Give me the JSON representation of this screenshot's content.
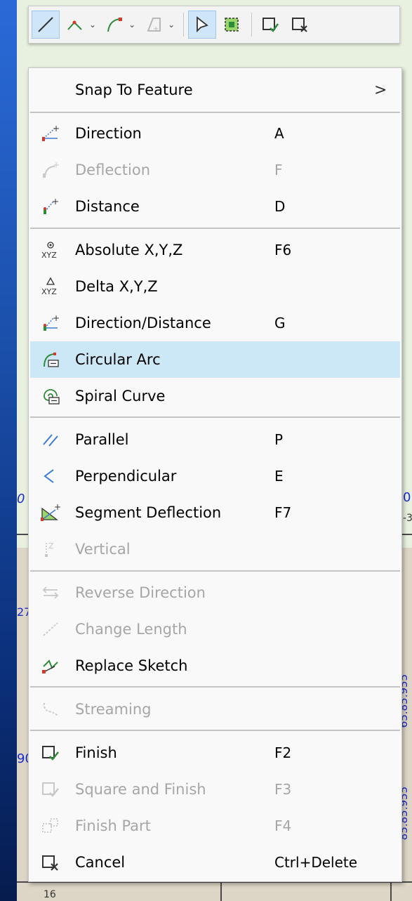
{
  "toolbar": {
    "buttons": [
      {
        "name": "line-segment-icon",
        "active": true
      },
      {
        "name": "polyline-icon",
        "dropdown": true
      },
      {
        "name": "arc-segment-icon",
        "dropdown": true
      },
      {
        "name": "construction-icon",
        "dropdown": true
      },
      {
        "name": "select-arrow-icon",
        "active": true
      },
      {
        "name": "vertex-select-icon"
      },
      {
        "name": "finish-sketch-icon"
      },
      {
        "name": "cancel-sketch-icon"
      }
    ]
  },
  "map": {
    "labels": [
      "0",
      "0",
      "27",
      "90",
      "16",
      "65.85.955",
      "85.85.955",
      "-3"
    ]
  },
  "menu": {
    "items": [
      {
        "id": "snap",
        "label": "Snap To Feature",
        "key": "",
        "submenu": true,
        "enabled": true
      },
      {
        "id": "direction",
        "label": "Direction",
        "key": "A",
        "enabled": true
      },
      {
        "id": "deflection",
        "label": "Deflection",
        "key": "F",
        "enabled": false
      },
      {
        "id": "distance",
        "label": "Distance",
        "key": "D",
        "enabled": true
      },
      {
        "id": "absolute",
        "label": "Absolute X,Y,Z",
        "key": "F6",
        "enabled": true
      },
      {
        "id": "delta",
        "label": "Delta X,Y,Z",
        "key": "",
        "enabled": true
      },
      {
        "id": "dirdist",
        "label": "Direction/Distance",
        "key": "G",
        "enabled": true
      },
      {
        "id": "circarc",
        "label": "Circular Arc",
        "key": "",
        "enabled": true,
        "highlighted": true
      },
      {
        "id": "spiral",
        "label": "Spiral Curve",
        "key": "",
        "enabled": true
      },
      {
        "id": "parallel",
        "label": "Parallel",
        "key": "P",
        "enabled": true
      },
      {
        "id": "perp",
        "label": "Perpendicular",
        "key": "E",
        "enabled": true
      },
      {
        "id": "segdefl",
        "label": "Segment Deflection",
        "key": "F7",
        "enabled": true
      },
      {
        "id": "vertical",
        "label": "Vertical",
        "key": "",
        "enabled": false
      },
      {
        "id": "revdir",
        "label": "Reverse Direction",
        "key": "",
        "enabled": false
      },
      {
        "id": "chglen",
        "label": "Change Length",
        "key": "",
        "enabled": false
      },
      {
        "id": "replace",
        "label": "Replace Sketch",
        "key": "",
        "enabled": true
      },
      {
        "id": "streaming",
        "label": "Streaming",
        "key": "",
        "enabled": false
      },
      {
        "id": "finish",
        "label": "Finish",
        "key": "F2",
        "enabled": true
      },
      {
        "id": "sqfinish",
        "label": "Square and Finish",
        "key": "F3",
        "enabled": false
      },
      {
        "id": "finpart",
        "label": "Finish Part",
        "key": "F4",
        "enabled": false
      },
      {
        "id": "cancel",
        "label": "Cancel",
        "key": "Ctrl+Delete",
        "enabled": true
      }
    ],
    "submenu_arrow": ">"
  },
  "colors": {
    "highlight": "#cce8f7",
    "accent_green": "#2e8b3a",
    "accent_red": "#d43a2a",
    "accent_blue": "#3a7bd5",
    "disabled": "#a6a6a6"
  }
}
